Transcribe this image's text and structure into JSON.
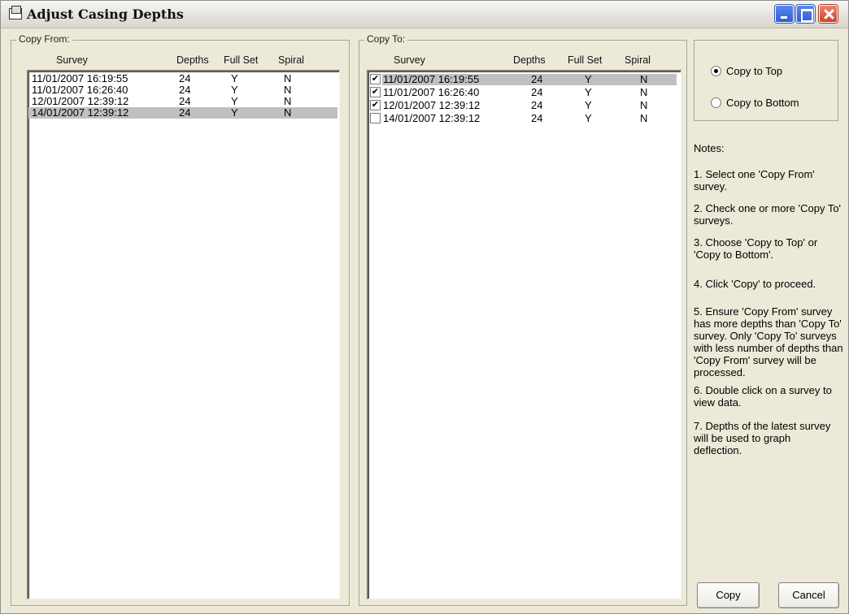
{
  "window": {
    "title": "Adjust Casing Depths"
  },
  "copy_from": {
    "label": "Copy From:",
    "columns": [
      "Survey",
      "Depths",
      "Full Set",
      "Spiral"
    ],
    "rows": [
      {
        "survey": "11/01/2007 16:19:55",
        "depths": "24",
        "full_set": "Y",
        "spiral": "N",
        "selected": false
      },
      {
        "survey": "11/01/2007 16:26:40",
        "depths": "24",
        "full_set": "Y",
        "spiral": "N",
        "selected": false
      },
      {
        "survey": "12/01/2007 12:39:12",
        "depths": "24",
        "full_set": "Y",
        "spiral": "N",
        "selected": false
      },
      {
        "survey": "14/01/2007 12:39:12",
        "depths": "24",
        "full_set": "Y",
        "spiral": "N",
        "selected": true
      }
    ]
  },
  "copy_to": {
    "label": "Copy To:",
    "columns": [
      "Survey",
      "Depths",
      "Full Set",
      "Spiral"
    ],
    "rows": [
      {
        "survey": "11/01/2007 16:19:55",
        "depths": "24",
        "full_set": "Y",
        "spiral": "N",
        "checked": true,
        "selected": true
      },
      {
        "survey": "11/01/2007 16:26:40",
        "depths": "24",
        "full_set": "Y",
        "spiral": "N",
        "checked": true,
        "selected": false
      },
      {
        "survey": "12/01/2007 12:39:12",
        "depths": "24",
        "full_set": "Y",
        "spiral": "N",
        "checked": true,
        "selected": false
      },
      {
        "survey": "14/01/2007 12:39:12",
        "depths": "24",
        "full_set": "Y",
        "spiral": "N",
        "checked": false,
        "selected": false
      }
    ]
  },
  "options": {
    "copy_to_top": "Copy to Top",
    "copy_to_bottom": "Copy to Bottom",
    "selected": "copy_to_top"
  },
  "notes": {
    "title": "Notes:",
    "items": [
      "1. Select one 'Copy From' survey.",
      "2. Check one or more 'Copy To' surveys.",
      "3. Choose 'Copy to Top' or 'Copy to Bottom'.",
      "4. Click 'Copy' to proceed.",
      "5. Ensure 'Copy From' survey has more depths than 'Copy To' survey.  Only 'Copy To' surveys with less number of depths than 'Copy From' survey will be processed.",
      "6. Double click on a survey to view data.",
      "7. Depths of the latest survey will be used to graph deflection."
    ]
  },
  "buttons": {
    "copy": "Copy",
    "cancel": "Cancel"
  }
}
